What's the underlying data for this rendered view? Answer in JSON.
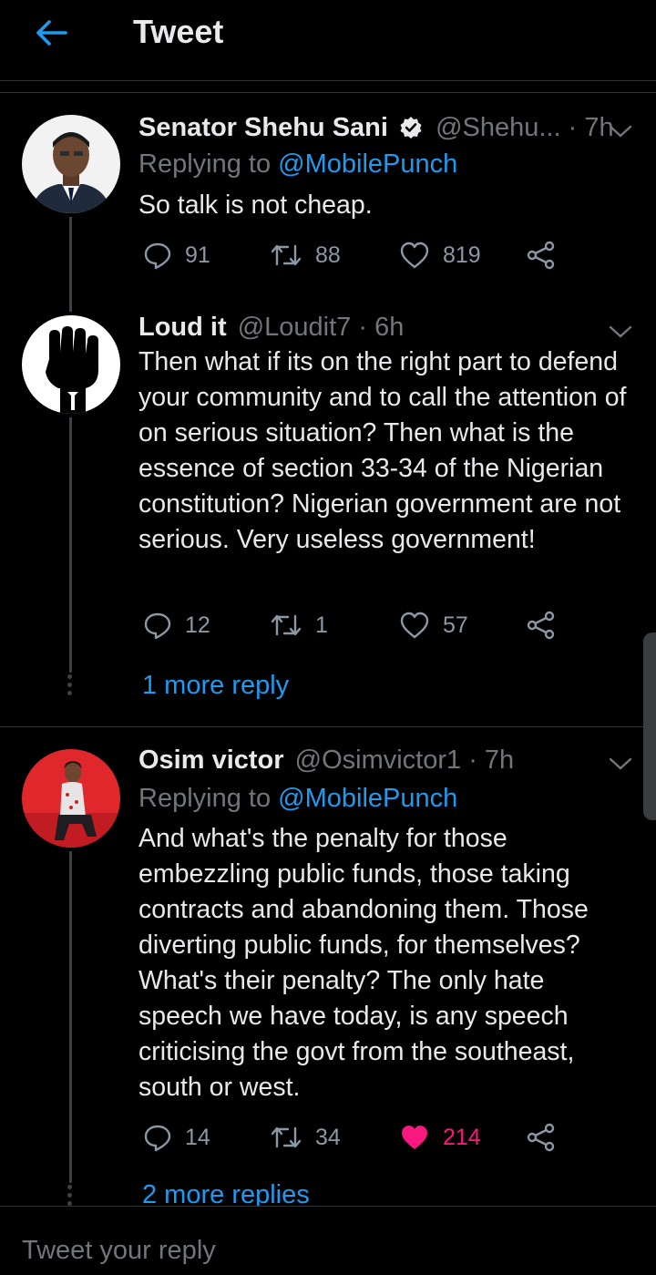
{
  "header": {
    "title": "Tweet"
  },
  "tweets": [
    {
      "name": "Senator Shehu Sani",
      "handle": "@Shehu...",
      "time": "· 7h",
      "replying_prefix": "Replying to ",
      "replying_to": "@MobilePunch",
      "text": "So talk is not cheap.",
      "replies": "91",
      "retweets": "88",
      "likes": "819",
      "verified": true
    },
    {
      "name": "Loud it",
      "handle": "@Loudit7",
      "time": "· 6h",
      "text": "Then what if its on the right part to defend your community and to call the attention of on serious situation? Then what is the essence of section 33-34 of the Nigerian constitution? Nigerian government are not serious. Very useless government!",
      "replies": "12",
      "retweets": "1",
      "likes": "57",
      "more_replies": "1 more reply"
    },
    {
      "name": "Osim victor",
      "handle": "@Osimvictor1",
      "time": "· 7h",
      "replying_prefix": "Replying to ",
      "replying_to": "@MobilePunch",
      "text": "And what's the penalty for those embezzling public funds, those taking contracts and abandoning them. Those diverting public funds, for themselves? What's their penalty? The only hate speech we have today, is any speech criticising the govt from the southeast, south or west.",
      "replies": "14",
      "retweets": "34",
      "likes": "214",
      "liked": true,
      "more_replies": "2 more replies"
    }
  ],
  "compose": {
    "placeholder": "Tweet your reply"
  },
  "colors": {
    "accent": "#1d9bf0",
    "like_active": "#f91880",
    "muted": "#71767b",
    "background": "#000000"
  },
  "icons": [
    "back-arrow-icon",
    "verified-badge-icon",
    "reply-icon",
    "retweet-icon",
    "like-icon",
    "share-icon",
    "chevron-down-icon"
  ]
}
